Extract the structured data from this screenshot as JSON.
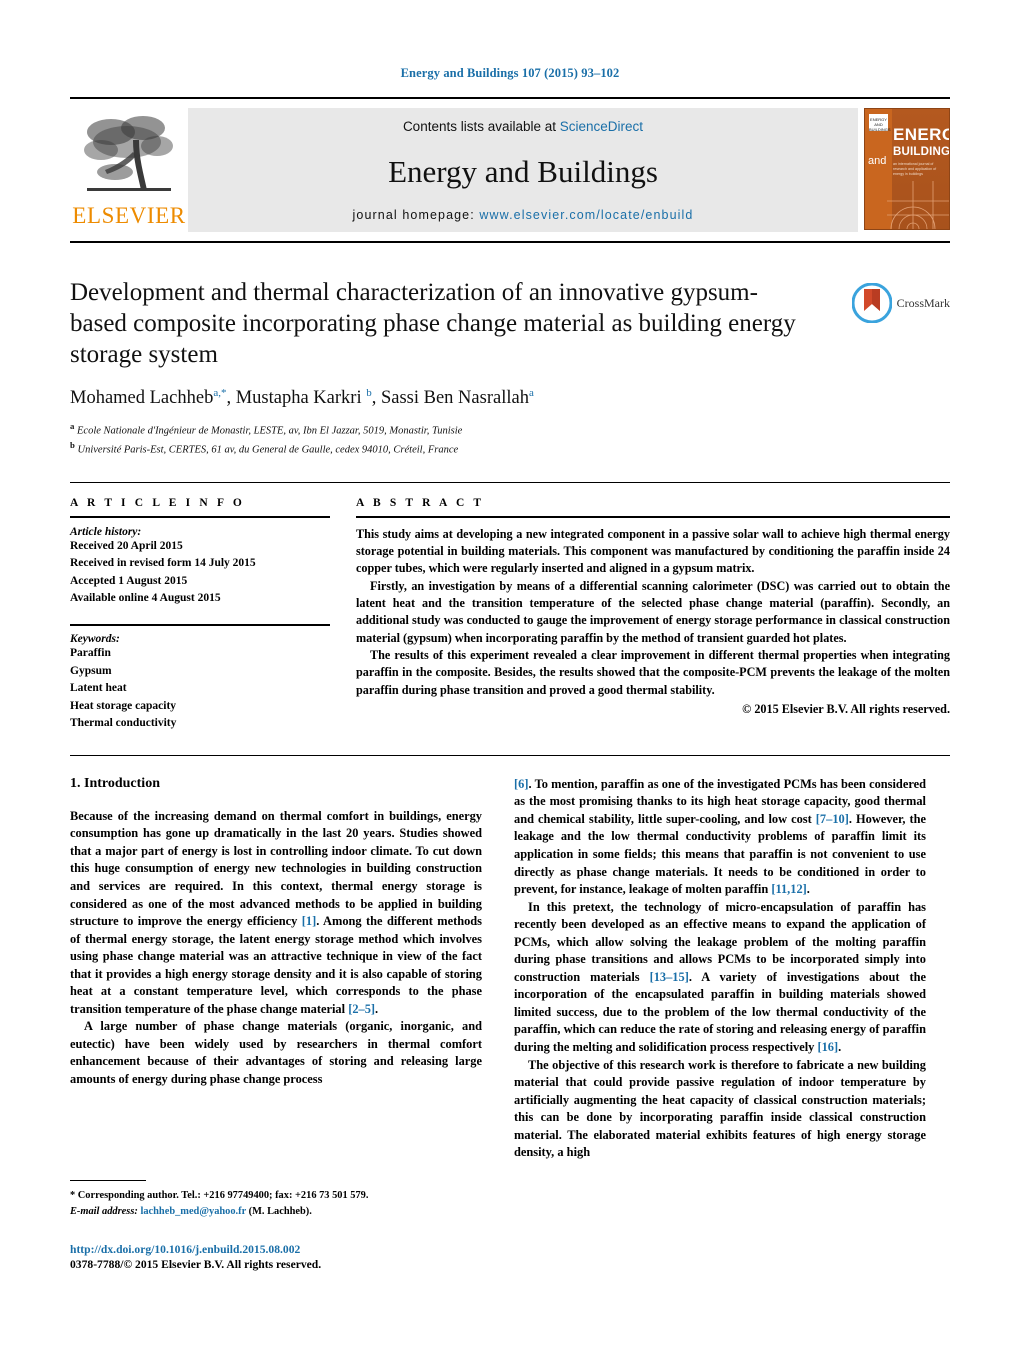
{
  "running_head": "Energy and Buildings 107 (2015) 93–102",
  "masthead": {
    "publisher_name": "ELSEVIER",
    "contents_prefix": "Contents lists available at ",
    "contents_link": "ScienceDirect",
    "journal_title": "Energy and Buildings",
    "homepage_label": "journal homepage:",
    "homepage_url": "www.elsevier.com/locate/enbuild",
    "cover": {
      "line_and": "and",
      "line_energy": "ENERGY",
      "line_buildings": "BUILDINGS",
      "sub": "an international journal of research and application of energy in buildings",
      "badge": "ENERGY AND BUILDINGS"
    }
  },
  "article": {
    "title": "Development and thermal characterization of an innovative gypsum-based composite incorporating phase change material as building energy storage system",
    "authors_html": "Mohamed Lachheb<sup>a,*</sup>, Mustapha Karkri <sup>b</sup>, Sassi Ben Nasrallah<sup>a</sup>",
    "affiliation_a": "Ecole Nationale d'Ingénieur de Monastir, LESTE, av, Ibn El Jazzar, 5019, Monastir, Tunisie",
    "affiliation_b": "Université Paris-Est, CERTES, 61 av, du General de Gaulle, cedex 94010, Créteil, France",
    "crossmark_label": "CrossMark"
  },
  "info": {
    "heading": "A R T I C L E   I N F O",
    "history_label": "Article history:",
    "history": [
      "Received 20 April 2015",
      "Received in revised form 14 July 2015",
      "Accepted 1 August 2015",
      "Available online 4 August 2015"
    ],
    "keywords_label": "Keywords:",
    "keywords": [
      "Paraffin",
      "Gypsum",
      "Latent heat",
      "Heat storage capacity",
      "Thermal conductivity"
    ]
  },
  "abstract": {
    "heading": "A B S T R A C T",
    "paragraphs": [
      "This study aims at developing a new integrated component in a passive solar wall to achieve high thermal energy storage potential in building materials. This component was manufactured by conditioning the paraffin inside 24 copper tubes, which were regularly inserted and aligned in a gypsum matrix.",
      "Firstly, an investigation by means of a differential scanning calorimeter (DSC) was carried out to obtain the latent heat and the transition temperature of the selected phase change material (paraffin). Secondly, an additional study was conducted to gauge the improvement of energy storage performance in classical construction material (gypsum) when incorporating paraffin by the method of transient guarded hot plates.",
      "The results of this experiment revealed a clear improvement in different thermal properties when integrating paraffin in the composite. Besides, the results showed that the composite-PCM prevents the leakage of the molten paraffin during phase transition and proved a good thermal stability."
    ],
    "copyright": "© 2015 Elsevier B.V. All rights reserved."
  },
  "introduction": {
    "heading": "1.  Introduction",
    "left_p1_a": "Because of the increasing demand on thermal comfort in buildings, energy consumption has gone up dramatically in the last 20 years. Studies showed that a major part of energy is lost in controlling indoor climate. To cut down this huge consumption of energy new technologies in building construction and services are required. In this context, thermal energy storage is considered as one of the most advanced methods to be applied in building structure to improve the energy efficiency ",
    "ref_1": "[1]",
    "left_p1_b": ". Among the different methods of thermal energy storage, the latent energy storage method which involves using phase change material was an attractive technique in view of the fact that it provides a high energy storage density and it is also capable of storing heat at a constant temperature level, which corresponds to the phase transition temperature of the phase change material ",
    "ref_2_5": "[2–5]",
    "left_p1_c": ".",
    "left_p2": "A large number of phase change materials (organic, inorganic, and eutectic) have been widely used by researchers in thermal comfort enhancement because of their advantages of storing and releasing large amounts of energy during phase change process",
    "ref_6": "[6]",
    "right_p1_a": ". To mention, paraffin as one of the investigated PCMs has been considered as the most promising thanks to its high heat storage capacity, good thermal and chemical stability, little super-cooling, and low cost ",
    "ref_7_10": "[7–10]",
    "right_p1_b": ". However, the leakage and the low thermal conductivity problems of paraffin limit its application in some fields; this means that paraffin is not convenient to use directly as phase change materials. It needs to be conditioned in order to prevent, for instance, leakage of molten paraffin ",
    "ref_11_12": "[11,12]",
    "right_p1_c": ".",
    "right_p2_a": "In this pretext, the technology of micro-encapsulation of paraffin has recently been developed as an effective means to expand the application of PCMs, which allow solving the leakage problem of the molting paraffin during phase transitions and allows PCMs to be incorporated simply into construction materials ",
    "ref_13_15": "[13–15]",
    "right_p2_b": ". A variety of investigations about the incorporation of the encapsulated paraffin in building materials showed limited success, due to the problem of the low thermal conductivity of the paraffin, which can reduce the rate of storing and releasing energy of paraffin during the melting and solidification process respectively ",
    "ref_16": "[16]",
    "right_p2_c": ".",
    "right_p3": "The objective of this research work is therefore to fabricate a new building material that could provide passive regulation of indoor temperature by artificially augmenting the heat capacity of classical construction materials; this can be done by incorporating paraffin inside classical construction material. The elaborated material exhibits features of high energy storage density, a high"
  },
  "footnote": {
    "corresponding": "* Corresponding author. Tel.: +216 97749400; fax: +216 73 501 579.",
    "email_label": "E-mail address:",
    "email": "lachheb_med@yahoo.fr",
    "email_suffix": "(M. Lachheb)."
  },
  "page_footer": {
    "doi": "http://dx.doi.org/10.1016/j.enbuild.2015.08.002",
    "issn": "0378-7788/© 2015 Elsevier B.V. All rights reserved."
  },
  "colors": {
    "link": "#1a6fa8",
    "elsevier_orange": "#ED8B00",
    "cover_orange": "#b4591f"
  }
}
